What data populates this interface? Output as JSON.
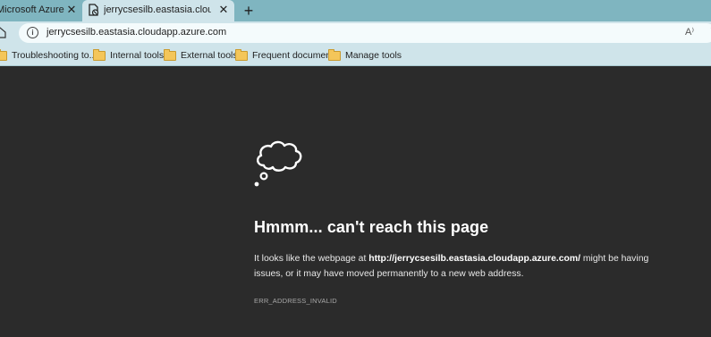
{
  "tabs": [
    {
      "title": "Microsoft Azure",
      "close": "✕"
    },
    {
      "title": "jerrycsesilb.eastasia.cloudapp.azure.com",
      "close": "✕"
    }
  ],
  "new_tab": "+",
  "address_bar": {
    "url": "jerrycsesilb.eastasia.cloudapp.azure.com",
    "info": "i",
    "read_aloud": "A⁾"
  },
  "favorites": [
    {
      "label": "Troubleshooting to..."
    },
    {
      "label": "Internal tools"
    },
    {
      "label": "External tools"
    },
    {
      "label": "Frequent document"
    },
    {
      "label": "Manage tools"
    }
  ],
  "error": {
    "title": "Hmmm... can't reach this page",
    "desc_prefix": "It looks like the webpage at ",
    "desc_url": "http://jerrycsesilb.eastasia.cloudapp.azure.com/",
    "desc_suffix": " might be having issues, or it may have moved permanently to a new web address.",
    "code": "ERR_ADDRESS_INVALID"
  },
  "colors": {
    "tabstrip": "#7fb5c0",
    "toolbar": "#cfe4ea",
    "page_bg": "#2b2b2b",
    "folder": "#f4c65a"
  }
}
